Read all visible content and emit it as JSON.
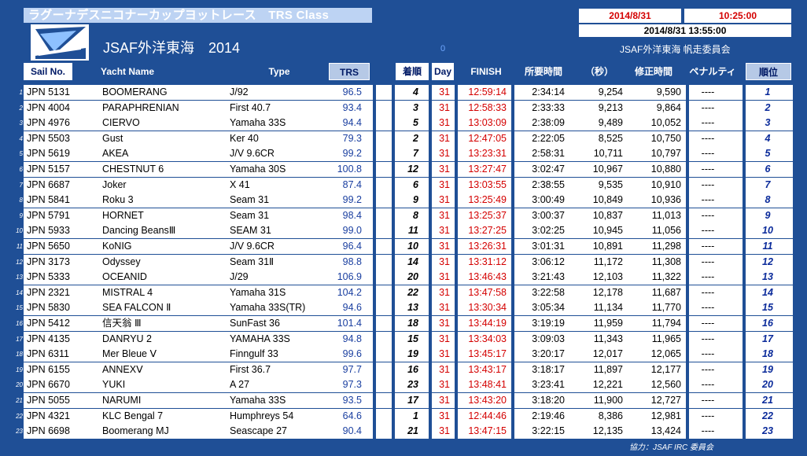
{
  "header": {
    "title": "ラグーナデスニコナーカップヨットレース　TRS Class",
    "date": "2014/8/31",
    "time": "10:25:00",
    "update_stamp": "2014/8/31 13:55:00",
    "event_name": "JSAF外洋東海　2014",
    "zero_mark": "0",
    "committee": "JSAF外洋東海 帆走委員会"
  },
  "columns": {
    "sail_no": "Sail No.",
    "yacht_name": "Yacht Name",
    "type": "Type",
    "trs": "TRS",
    "arrival": "着順",
    "day": "Day",
    "finish": "FINISH",
    "elapsed": "所要時間",
    "seconds": "（秒）",
    "corrected": "修正時間",
    "penalty": "ペナルティ",
    "rank": "順位"
  },
  "rows": [
    {
      "n": "1",
      "sail": "JPN 5131",
      "name": "BOOMERANG",
      "type": "J/92",
      "trs": "96.5",
      "arr": "4",
      "day": "31",
      "finish": "12:59:14",
      "elapsed": "2:34:14",
      "sec": "9,254",
      "corr": "9,590",
      "pen": "----",
      "rank": "1"
    },
    {
      "n": "2",
      "sail": "JPN 4004",
      "name": "PARAPHRENIAN",
      "type": "First 40.7",
      "trs": "93.4",
      "arr": "3",
      "day": "31",
      "finish": "12:58:33",
      "elapsed": "2:33:33",
      "sec": "9,213",
      "corr": "9,864",
      "pen": "----",
      "rank": "2"
    },
    {
      "n": "3",
      "sail": "JPN 4976",
      "name": "CIERVO",
      "type": "Yamaha 33S",
      "trs": "94.4",
      "arr": "5",
      "day": "31",
      "finish": "13:03:09",
      "elapsed": "2:38:09",
      "sec": "9,489",
      "corr": "10,052",
      "pen": "----",
      "rank": "3"
    },
    {
      "n": "4",
      "sail": "JPN 5503",
      "name": "Gust",
      "type": "Ker 40",
      "trs": "79.3",
      "arr": "2",
      "day": "31",
      "finish": "12:47:05",
      "elapsed": "2:22:05",
      "sec": "8,525",
      "corr": "10,750",
      "pen": "----",
      "rank": "4"
    },
    {
      "n": "5",
      "sail": "JPN 5619",
      "name": "AKEA",
      "type": "J/V 9.6CR",
      "trs": "99.2",
      "arr": "7",
      "day": "31",
      "finish": "13:23:31",
      "elapsed": "2:58:31",
      "sec": "10,711",
      "corr": "10,797",
      "pen": "----",
      "rank": "5"
    },
    {
      "n": "6",
      "sail": "JPN 5157",
      "name": "CHESTNUT 6",
      "type": "Yamaha 30S",
      "trs": "100.8",
      "arr": "12",
      "day": "31",
      "finish": "13:27:47",
      "elapsed": "3:02:47",
      "sec": "10,967",
      "corr": "10,880",
      "pen": "----",
      "rank": "6"
    },
    {
      "n": "7",
      "sail": "JPN 6687",
      "name": "Joker",
      "type": "X 41",
      "trs": "87.4",
      "arr": "6",
      "day": "31",
      "finish": "13:03:55",
      "elapsed": "2:38:55",
      "sec": "9,535",
      "corr": "10,910",
      "pen": "----",
      "rank": "7"
    },
    {
      "n": "8",
      "sail": "JPN 5841",
      "name": "Roku 3",
      "type": "Seam 31",
      "trs": "99.2",
      "arr": "9",
      "day": "31",
      "finish": "13:25:49",
      "elapsed": "3:00:49",
      "sec": "10,849",
      "corr": "10,936",
      "pen": "----",
      "rank": "8"
    },
    {
      "n": "9",
      "sail": "JPN 5791",
      "name": "HORNET",
      "type": "Seam 31",
      "trs": "98.4",
      "arr": "8",
      "day": "31",
      "finish": "13:25:37",
      "elapsed": "3:00:37",
      "sec": "10,837",
      "corr": "11,013",
      "pen": "----",
      "rank": "9"
    },
    {
      "n": "10",
      "sail": "JPN 5933",
      "name": "Dancing BeansⅢ",
      "type": "SEAM 31",
      "trs": "99.0",
      "arr": "11",
      "day": "31",
      "finish": "13:27:25",
      "elapsed": "3:02:25",
      "sec": "10,945",
      "corr": "11,056",
      "pen": "----",
      "rank": "10"
    },
    {
      "n": "11",
      "sail": "JPN 5650",
      "name": "KoNIG",
      "type": "J/V 9.6CR",
      "trs": "96.4",
      "arr": "10",
      "day": "31",
      "finish": "13:26:31",
      "elapsed": "3:01:31",
      "sec": "10,891",
      "corr": "11,298",
      "pen": "----",
      "rank": "11"
    },
    {
      "n": "12",
      "sail": "JPN 3173",
      "name": "Odyssey",
      "type": "Seam 31Ⅱ",
      "trs": "98.8",
      "arr": "14",
      "day": "31",
      "finish": "13:31:12",
      "elapsed": "3:06:12",
      "sec": "11,172",
      "corr": "11,308",
      "pen": "----",
      "rank": "12"
    },
    {
      "n": "13",
      "sail": "JPN 5333",
      "name": "OCEANID",
      "type": "J/29",
      "trs": "106.9",
      "arr": "20",
      "day": "31",
      "finish": "13:46:43",
      "elapsed": "3:21:43",
      "sec": "12,103",
      "corr": "11,322",
      "pen": "----",
      "rank": "13"
    },
    {
      "n": "14",
      "sail": "JPN 2321",
      "name": "MISTRAL 4",
      "type": "Yamaha 31S",
      "trs": "104.2",
      "arr": "22",
      "day": "31",
      "finish": "13:47:58",
      "elapsed": "3:22:58",
      "sec": "12,178",
      "corr": "11,687",
      "pen": "----",
      "rank": "14"
    },
    {
      "n": "15",
      "sail": "JPN 5830",
      "name": "SEA FALCON Ⅱ",
      "type": "Yamaha 33S(TR)",
      "trs": "94.6",
      "arr": "13",
      "day": "31",
      "finish": "13:30:34",
      "elapsed": "3:05:34",
      "sec": "11,134",
      "corr": "11,770",
      "pen": "----",
      "rank": "15"
    },
    {
      "n": "16",
      "sail": "JPN 5412",
      "name": "信天翁 Ⅲ",
      "type": "SunFast 36",
      "trs": "101.4",
      "arr": "18",
      "day": "31",
      "finish": "13:44:19",
      "elapsed": "3:19:19",
      "sec": "11,959",
      "corr": "11,794",
      "pen": "----",
      "rank": "16"
    },
    {
      "n": "17",
      "sail": "JPN 4135",
      "name": "DANRYU 2",
      "type": "YAMAHA 33S",
      "trs": "94.8",
      "arr": "15",
      "day": "31",
      "finish": "13:34:03",
      "elapsed": "3:09:03",
      "sec": "11,343",
      "corr": "11,965",
      "pen": "----",
      "rank": "17"
    },
    {
      "n": "18",
      "sail": "JPN 6311",
      "name": "Mer Bleue Ⅴ",
      "type": "Finngulf 33",
      "trs": "99.6",
      "arr": "19",
      "day": "31",
      "finish": "13:45:17",
      "elapsed": "3:20:17",
      "sec": "12,017",
      "corr": "12,065",
      "pen": "----",
      "rank": "18"
    },
    {
      "n": "19",
      "sail": "JPN 6155",
      "name": "ANNEXⅤ",
      "type": "First 36.7",
      "trs": "97.7",
      "arr": "16",
      "day": "31",
      "finish": "13:43:17",
      "elapsed": "3:18:17",
      "sec": "11,897",
      "corr": "12,177",
      "pen": "----",
      "rank": "19"
    },
    {
      "n": "20",
      "sail": "JPN 6670",
      "name": "YUKI",
      "type": "A 27",
      "trs": "97.3",
      "arr": "23",
      "day": "31",
      "finish": "13:48:41",
      "elapsed": "3:23:41",
      "sec": "12,221",
      "corr": "12,560",
      "pen": "----",
      "rank": "20"
    },
    {
      "n": "21",
      "sail": "JPN 5055",
      "name": "NARUMI",
      "type": "Yamaha 33S",
      "trs": "93.5",
      "arr": "17",
      "day": "31",
      "finish": "13:43:20",
      "elapsed": "3:18:20",
      "sec": "11,900",
      "corr": "12,727",
      "pen": "----",
      "rank": "21"
    },
    {
      "n": "22",
      "sail": "JPN 4321",
      "name": "KLC Bengal 7",
      "type": "Humphreys 54",
      "trs": "64.6",
      "arr": "1",
      "day": "31",
      "finish": "12:44:46",
      "elapsed": "2:19:46",
      "sec": "8,386",
      "corr": "12,981",
      "pen": "----",
      "rank": "22"
    },
    {
      "n": "23",
      "sail": "JPN 6698",
      "name": "Boomerang MJ",
      "type": "Seascape 27",
      "trs": "90.4",
      "arr": "21",
      "day": "31",
      "finish": "13:47:15",
      "elapsed": "3:22:15",
      "sec": "12,135",
      "corr": "13,424",
      "pen": "----",
      "rank": "23"
    }
  ],
  "footer": {
    "credit": "協力：JSAF IRC 委員会"
  },
  "colors": {
    "background": "#1f4f96",
    "title_bar": "#bdd3f3",
    "finish_red": "#d40000",
    "trs_blue": "#1a3fa0",
    "rank_blue": "#0a2a9a"
  }
}
